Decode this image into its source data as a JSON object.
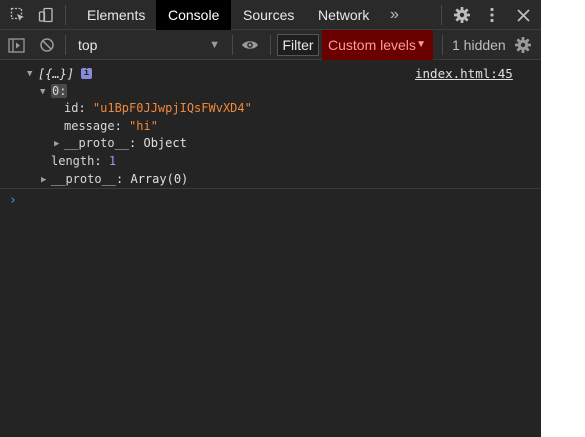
{
  "tabs": {
    "items": [
      {
        "label": "Elements"
      },
      {
        "label": "Console"
      },
      {
        "label": "Sources"
      },
      {
        "label": "Network"
      }
    ],
    "more_label": "»",
    "icons": [
      "inspect-element-icon",
      "device-toolbar-icon",
      "more-tabs-icon",
      "settings-icon",
      "kebab-menu-icon",
      "close-icon"
    ]
  },
  "toolbar": {
    "context": "top",
    "filter_label": "Filter",
    "levels_label": "Custom levels",
    "hidden_label": "1 hidden",
    "icons": [
      "sidebar-toggle-icon",
      "clear-console-icon",
      "eye-icon",
      "settings-icon"
    ]
  },
  "log": {
    "summary": "[{…}]",
    "info_badge": "i",
    "source": "index.html:45",
    "index": "0:",
    "id_key": "id",
    "id_value": "\"u1BpF0JJwpjIQsFWvXD4\"",
    "message_key": "message",
    "message_value": "\"hi\"",
    "proto1_key": "__proto__",
    "proto1_value": "Object",
    "length_key": "length",
    "length_value": "1",
    "proto2_key": "__proto__",
    "proto2_value": "Array(0)"
  },
  "prompt_symbol": "›",
  "colors": {
    "panel_bg": "#242424",
    "active_tab_bg": "#000000",
    "levels_bg": "#6b0000",
    "string_value": "#f0883e",
    "number_value": "#9999ff",
    "prompt": "#4b8df8"
  }
}
